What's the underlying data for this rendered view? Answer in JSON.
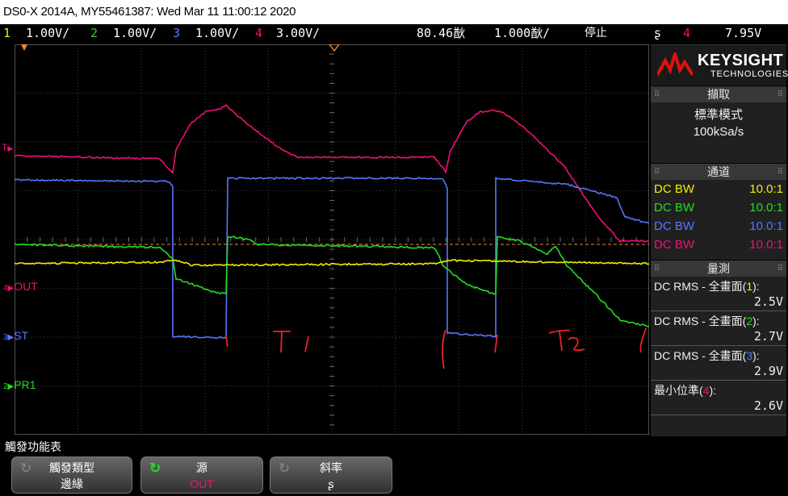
{
  "title": "DS0-X 2014A, MY55461387: Wed Mar 11 11:00:12 2020",
  "channels": [
    {
      "num": "1",
      "scale": "1.00V/",
      "color": "#f0f000"
    },
    {
      "num": "2",
      "scale": "1.00V/",
      "color": "#22dd22"
    },
    {
      "num": "3",
      "scale": "1.00V/",
      "color": "#5577ff"
    },
    {
      "num": "4",
      "scale": "3.00V/",
      "color": "#ee1177"
    }
  ],
  "timebase": {
    "delay": "80.46㷕",
    "scale": "1.000㷕/"
  },
  "run_state": "停止",
  "trigger": {
    "slope_icon": "rising-edge-icon",
    "slope_glyph": "ʂ",
    "source": "4",
    "level": "7.95V"
  },
  "brand": {
    "name": "KEYSIGHT",
    "sub": "TECHNOLOGIES"
  },
  "acquire": {
    "header": "擷取",
    "mode": "標準模式",
    "rate": "100kSa/s"
  },
  "channels_panel": {
    "header": "通道",
    "rows": [
      {
        "coupling": "DC BW",
        "probe": "10.0:1",
        "color": "#f0f000"
      },
      {
        "coupling": "DC BW",
        "probe": "10.0:1",
        "color": "#22dd22"
      },
      {
        "coupling": "DC BW",
        "probe": "10.0:1",
        "color": "#5577ff"
      },
      {
        "coupling": "DC BW",
        "probe": "10.0:1",
        "color": "#ee1177"
      }
    ]
  },
  "measure_panel": {
    "header": "量測",
    "items": [
      {
        "pre": "DC RMS - 全畫面(",
        "src": "1",
        ")": ")",
        "post": "):",
        "value": "2.5V",
        "color": "#f0f000"
      },
      {
        "pre": "DC RMS - 全畫面(",
        "src": "2",
        "post": "):",
        "value": "2.7V",
        "color": "#22dd22"
      },
      {
        "pre": "DC RMS - 全畫面(",
        "src": "3",
        "post": "):",
        "value": "2.9V",
        "color": "#5577ff"
      },
      {
        "pre": "最小位準(",
        "src": "4",
        "post": "):",
        "value": "2.6V",
        "color": "#ee1177"
      }
    ]
  },
  "channel_labels": [
    {
      "text": "OUT",
      "color": "#ee1177"
    },
    {
      "text": "ST",
      "color": "#5577ff"
    },
    {
      "text": "PR1",
      "color": "#22dd22"
    }
  ],
  "trigger_marker": {
    "text": "T",
    "color": "#ee1177"
  },
  "annotations": [
    {
      "text": "T 1"
    },
    {
      "text": "T2"
    }
  ],
  "menu": {
    "title": "觸發功能表",
    "buttons": [
      {
        "label": "觸發類型",
        "value": "邊緣",
        "value_color": "#ffffff"
      },
      {
        "label": "源",
        "value": "OUT",
        "value_color": "#ee1177"
      },
      {
        "label": "斜率",
        "value": "ʂ",
        "value_color": "#ffffff"
      }
    ]
  }
}
